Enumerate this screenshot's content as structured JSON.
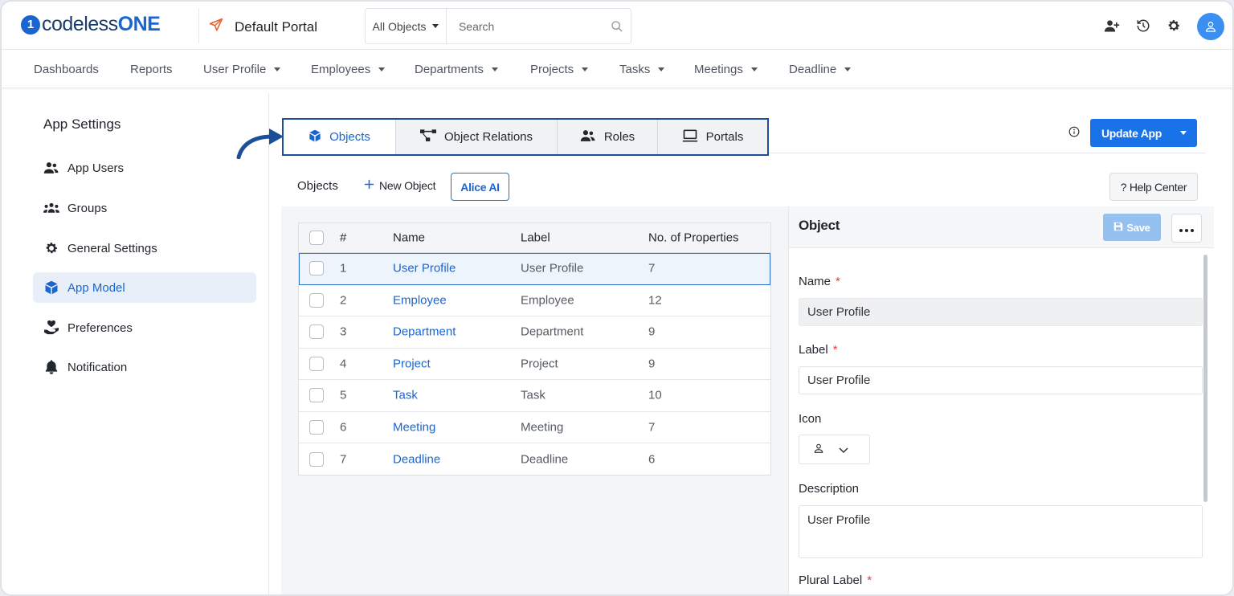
{
  "brand": {
    "logo_prefix": "codeless",
    "logo_suffix": "ONE",
    "accent": "#1a66d1"
  },
  "portal": {
    "name": "Default Portal"
  },
  "search": {
    "scope": "All Objects",
    "placeholder": "Search"
  },
  "nav": {
    "items": [
      {
        "label": "Dashboards",
        "dropdown": false
      },
      {
        "label": "Reports",
        "dropdown": false
      },
      {
        "label": "User Profile",
        "dropdown": true
      },
      {
        "label": "Employees",
        "dropdown": true
      },
      {
        "label": "Departments",
        "dropdown": true
      },
      {
        "label": "Projects",
        "dropdown": true
      },
      {
        "label": "Tasks",
        "dropdown": true
      },
      {
        "label": "Meetings",
        "dropdown": true
      },
      {
        "label": "Deadline",
        "dropdown": true
      }
    ]
  },
  "sidebar": {
    "title": "App Settings",
    "items": [
      {
        "label": "App Users",
        "icon": "users-icon"
      },
      {
        "label": "Groups",
        "icon": "group-icon"
      },
      {
        "label": "General Settings",
        "icon": "gear-icon"
      },
      {
        "label": "App Model",
        "icon": "cube-icon",
        "active": true
      },
      {
        "label": "Preferences",
        "icon": "hand-heart-icon"
      },
      {
        "label": "Notification",
        "icon": "bell-icon"
      }
    ]
  },
  "tabs": [
    {
      "label": "Objects",
      "icon": "cube-icon",
      "active": true
    },
    {
      "label": "Object Relations",
      "icon": "relations-icon"
    },
    {
      "label": "Roles",
      "icon": "users-icon"
    },
    {
      "label": "Portals",
      "icon": "laptop-icon"
    }
  ],
  "actions": {
    "update_app": "Update App",
    "help_center": "? Help Center"
  },
  "toolbar": {
    "label": "Objects",
    "new_object": "New Object",
    "alice_ai": "Alice AI"
  },
  "grid": {
    "columns": [
      "#",
      "Name",
      "Label",
      "No. of Properties"
    ],
    "rows": [
      {
        "num": "1",
        "name": "User Profile",
        "label": "User Profile",
        "props": "7",
        "selected": true
      },
      {
        "num": "2",
        "name": "Employee",
        "label": "Employee",
        "props": "12"
      },
      {
        "num": "3",
        "name": "Department",
        "label": "Department",
        "props": "9"
      },
      {
        "num": "4",
        "name": "Project",
        "label": "Project",
        "props": "9"
      },
      {
        "num": "5",
        "name": "Task",
        "label": "Task",
        "props": "10"
      },
      {
        "num": "6",
        "name": "Meeting",
        "label": "Meeting",
        "props": "7"
      },
      {
        "num": "7",
        "name": "Deadline",
        "label": "Deadline",
        "props": "6"
      }
    ]
  },
  "detail": {
    "title": "Object",
    "save": "Save",
    "name_label": "Name",
    "name_value": "User Profile",
    "label_label": "Label",
    "label_value": "User Profile",
    "icon_label": "Icon",
    "description_label": "Description",
    "description_value": "User Profile",
    "plural_label": "Plural Label",
    "required_mark": "*"
  }
}
